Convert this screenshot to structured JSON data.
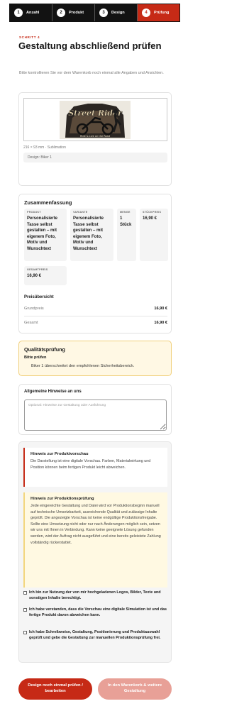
{
  "steps": [
    {
      "num": "1",
      "label": "Anzahl"
    },
    {
      "num": "2",
      "label": "Produkt"
    },
    {
      "num": "3",
      "label": "Design"
    },
    {
      "num": "4",
      "label": "Prüfung"
    }
  ],
  "active_step": 4,
  "header": {
    "kicker": "SCHRITT 4",
    "title": "Gestaltung abschließend prüfen",
    "subtitle": "Bitte kontrollieren Sie vor dem Warenkorb noch einmal alle Angaben und Ansichten."
  },
  "preview": {
    "meta": "216 × 93 mm · Sublimation",
    "design": "Design: Biker 1"
  },
  "summary": {
    "title": "Zusammenfassung",
    "product_label": "PRODUKT",
    "product_value": "Personalisierte Tasse selbst gestalten – mit eigenem Foto, Motiv und Wunschtext",
    "variant_label": "VARIANTE",
    "variant_value": "Personalisierte Tasse selbst gestalten – mit eigenem Foto, Motiv und Wunschtext",
    "qty_label": "MENGE",
    "qty_value": "1 Stück",
    "unit_label": "STÜCKPREIS",
    "unit_value": "16,90 €",
    "total_label": "GESAMTPREIS",
    "total_value": "16,90 €",
    "price_title": "Preisübersicht",
    "base_label": "Grundpreis",
    "base_value": "16,90 €",
    "sum_label": "Gesamt",
    "sum_value": "16,90 €"
  },
  "quality": {
    "title": "Qualitätsprüfung",
    "subtitle": "Bitte prüfen",
    "message": "Biker 1 überschreitet den empfohlenen Sicherheitsbereich."
  },
  "notes": {
    "title": "Allgemeine Hinweise an uns",
    "placeholder": "Optional: Hinweise zur Gestaltung oder Ausführung"
  },
  "hints": {
    "preview_title": "Hinweis zur Produktvorschau",
    "preview_text": "Die Darstellung ist eine digitale Vorschau. Farben, Materialwirkung und Position können beim fertigen Produkt leicht abweichen.",
    "check_title": "Hinweis zur Produktionsprüfung",
    "check_text": "Jede eingereichte Gestaltung und Datei wird vor Produktionsbeginn manuell auf technische Umsetzbarkeit, ausreichende Qualität und zulässige Inhalte geprüft. Die angezeigte Vorschau ist keine endgültige Produktionsfreigabe. Sollte eine Umsetzung nicht oder nur nach Änderungen möglich sein, setzen wir uns mit Ihnen in Verbindung. Kann keine geeignete Lösung gefunden werden, wird der Auftrag nicht ausgeführt und eine bereits geleistete Zahlung vollständig rückerstattet."
  },
  "checks": [
    "Ich bin zur Nutzung der von mir hochgeladenen Logos, Bilder, Texte und sonstigen Inhalte berechtigt.",
    "Ich habe verstanden, dass die Vorschau eine digitale Simulation ist und das fertige Produkt davon abweichen kann.",
    "Ich habe Schreibweise, Gestaltung, Positionierung und Produktauswahl geprüft und gebe die Gestaltung zur manuellen Produktionsprüfung frei."
  ],
  "buttons": {
    "back": "Design noch einmal prüfen / bearbeiten",
    "cart": "In den Warenkorb & weitere Gestaltung"
  },
  "art": {
    "title": "Street Rider",
    "caption": "Ride & Live on the Road"
  },
  "colors": {
    "accent": "#c62a16",
    "dark": "#121212",
    "warning_bg": "#fff8e4",
    "warning_border": "#f0cf7a"
  }
}
